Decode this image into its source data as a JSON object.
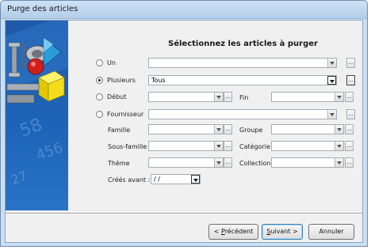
{
  "window": {
    "title": "Purge des articles"
  },
  "heading": "Sélectionnez les articles à purger",
  "mode": {
    "un_label": "Un",
    "plusieurs_label": "Plusieurs",
    "plusieurs_value": "Tous",
    "debut_label": "Début",
    "fin_label": "Fin",
    "fournisseur_label": "Fournisseur",
    "selected": "plusieurs"
  },
  "filters": {
    "famille_label": "Famille",
    "groupe_label": "Groupe",
    "sous_famille_label": "Sous-famille",
    "categorie_label": "Catégorie",
    "theme_label": "Thème",
    "collection_label": "Collection",
    "crees_avant_label": "Créés avant :",
    "crees_avant_value": "/ /"
  },
  "buttons": {
    "precedent_u": "P",
    "precedent_rest": "récédent",
    "precedent_prefix": "<",
    "suivant_u": "S",
    "suivant_rest": "uivant >",
    "annuler": "Annuler"
  },
  "icons": {
    "dropdown": "chevron-down-icon",
    "browse": "ellipsis-icon",
    "banner": "parts-illustration"
  },
  "colors": {
    "banner": "#1f5aa8",
    "window_frame": "#c9dff2"
  }
}
